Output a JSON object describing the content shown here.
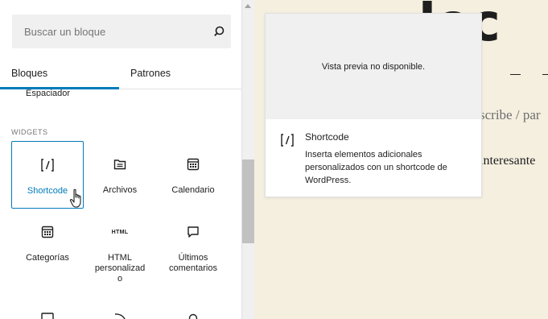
{
  "search": {
    "placeholder": "Buscar un bloque",
    "icon": "search-icon"
  },
  "tabs": [
    {
      "label": "Bloques",
      "active": true
    },
    {
      "label": "Patrones",
      "active": false
    }
  ],
  "scrolled_item": "Espaciador",
  "section": {
    "title": "WIDGETS"
  },
  "blocks": [
    {
      "label": "Shortcode",
      "icon": "shortcode-icon",
      "selected": true
    },
    {
      "label": "Archivos",
      "icon": "folder-icon",
      "selected": false
    },
    {
      "label": "Calendario",
      "icon": "calendar-icon",
      "selected": false
    },
    {
      "label": "Categorías",
      "icon": "categories-icon",
      "selected": false
    },
    {
      "label": "HTML\npersonalizad\no",
      "icon": "html-icon",
      "icon_text": "HTML",
      "selected": false
    },
    {
      "label": "Últimos\ncomentarios",
      "icon": "comment-icon",
      "selected": false
    }
  ],
  "preview": {
    "empty_message": "Vista previa no disponible.",
    "icon": "shortcode-icon",
    "icon_text": "[/]",
    "title": "Shortcode",
    "description": "Inserta elementos adicionales personalizados con un shortcode de WordPress."
  },
  "canvas": {
    "title_fragment": "...loc",
    "subtext": "scribe / par",
    "bodytext": "interesante"
  },
  "colors": {
    "accent": "#007cba",
    "canvas_bg": "#f5efe0",
    "search_bg": "#f0f0f0"
  }
}
